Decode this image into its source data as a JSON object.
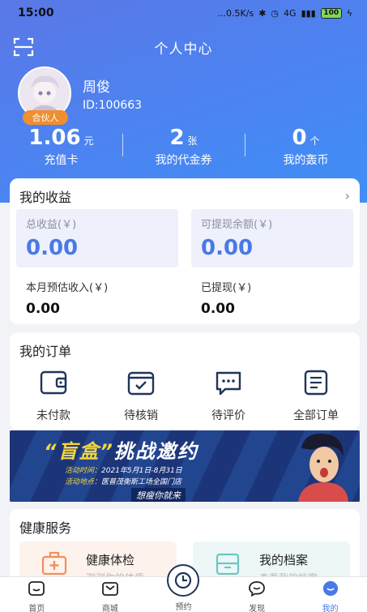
{
  "status_bar": {
    "time": "15:00",
    "network_speed": "...0.5K/s",
    "signal": "4G",
    "battery": "100"
  },
  "header": {
    "title": "个人中心"
  },
  "profile": {
    "name": "周俊",
    "id": "ID:100663",
    "badge": "合伙人"
  },
  "stats": [
    {
      "value": "1.06",
      "unit": "元",
      "label": "充值卡"
    },
    {
      "value": "2",
      "unit": "张",
      "label": "我的代金券"
    },
    {
      "value": "0",
      "unit": "个",
      "label": "我的轰币"
    }
  ],
  "earnings": {
    "title": "我的收益",
    "total_label": "总收益(￥)",
    "total_value": "0.00",
    "withdrawable_label": "可提现余额(￥)",
    "withdrawable_value": "0.00",
    "month_label": "本月预估收入(￥)",
    "month_value": "0.00",
    "withdrawn_label": "已提现(￥)",
    "withdrawn_value": "0.00"
  },
  "orders": {
    "title": "我的订单",
    "items": [
      {
        "label": "未付款",
        "icon": "wallet-icon"
      },
      {
        "label": "待核销",
        "icon": "box-check-icon"
      },
      {
        "label": "待评价",
        "icon": "chat-dots-icon"
      },
      {
        "label": "全部订单",
        "icon": "document-list-icon"
      }
    ]
  },
  "banner": {
    "headline_quote": "“盲盒”",
    "headline_rest": "挑战邀约",
    "line1_key": "活动时间：",
    "line1_value": "2021年5月1日-8月31日",
    "line2_key": "活动地点：",
    "line2_value": "医普茂衡斯工场全国门店",
    "line3": "想瘦你就来"
  },
  "health": {
    "title": "健康服务",
    "items": [
      {
        "title": "健康体检",
        "subtitle": "测测你的体质",
        "icon": "medkit-icon"
      },
      {
        "title": "我的档案",
        "subtitle": "查看我的档案",
        "icon": "archive-icon"
      }
    ]
  },
  "tabbar": [
    {
      "label": "首页",
      "icon": "home-icon"
    },
    {
      "label": "商城",
      "icon": "shop-bag-icon"
    },
    {
      "label": "预约",
      "icon": "clock-icon"
    },
    {
      "label": "发现",
      "icon": "discover-chat-icon"
    },
    {
      "label": "我的",
      "icon": "profile-smile-icon"
    }
  ],
  "colors": {
    "hero_gradient_start": "#5a78e6",
    "hero_gradient_end": "#3f8ff5",
    "accent_blue": "#4a78e6",
    "badge_orange": "#ef8f2f"
  }
}
